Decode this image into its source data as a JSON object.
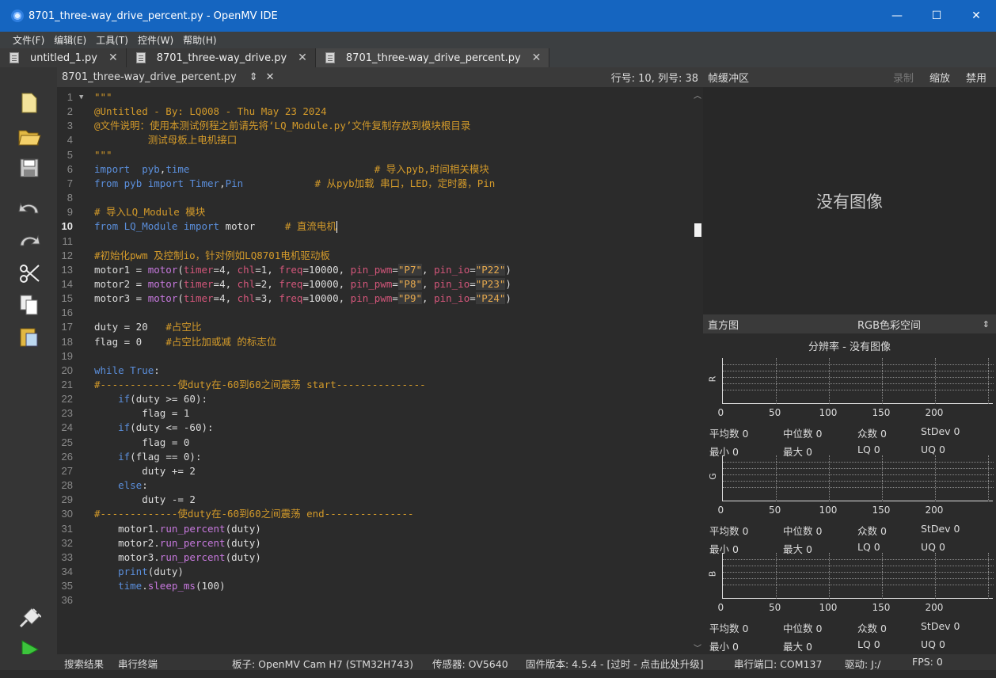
{
  "window": {
    "title": "8701_three-way_drive_percent.py - OpenMV IDE",
    "min": "—",
    "max": "☐",
    "close": "✕"
  },
  "menu": [
    "文件(F)",
    "编辑(E)",
    "工具(T)",
    "控件(W)",
    "帮助(H)"
  ],
  "tabs": [
    {
      "label": "untitled_1.py"
    },
    {
      "label": "8701_three-way_drive.py"
    },
    {
      "label": "8701_three-way_drive_percent.py"
    }
  ],
  "editor_header": {
    "file": "8701_three-way_drive_percent.py",
    "arrows": "⇕",
    "close": "✕",
    "position": "行号: 10, 列号: 38"
  },
  "code_lines": [
    "\"\"\"",
    "@Untitled - By: LQ008 - Thu May 23 2024",
    "@文件说明：使用本测试例程之前请先将‘LQ_Module.py’文件复制存放到模块根目录",
    "         测试母板上电机接口",
    "\"\"\"",
    "import  pyb,time                               # 导入pyb,时间相关模块",
    "from pyb import Timer,Pin            # 从pyb加载 串口，LED，定时器，Pin",
    "",
    "# 导入LQ_Module 模块",
    "from LQ_Module import motor     # 直流电机",
    "",
    "#初始化pwm 及控制io，针对例如LQ8701电机驱动板",
    "motor1 = motor(timer=4, chl=1, freq=10000, pin_pwm=\"P7\", pin_io=\"P22\")",
    "motor2 = motor(timer=4, chl=2, freq=10000, pin_pwm=\"P8\", pin_io=\"P23\")",
    "motor3 = motor(timer=4, chl=3, freq=10000, pin_pwm=\"P9\", pin_io=\"P24\")",
    "",
    "duty = 20   #占空比",
    "flag = 0    #占空比加或减 的标志位",
    "",
    "while True:",
    "#-------------使duty在-60到60之间震荡 start---------------",
    "    if(duty >= 60):",
    "        flag = 1",
    "    if(duty <= -60):",
    "        flag = 0",
    "    if(flag == 0):",
    "        duty += 2",
    "    else:",
    "        duty -= 2",
    "#-------------使duty在-60到60之间震荡 end---------------",
    "    motor1.run_percent(duty)",
    "    motor2.run_percent(duty)",
    "    motor3.run_percent(duty)",
    "    print(duty)",
    "    time.sleep_ms(100)",
    ""
  ],
  "framebuffer": {
    "label": "帧缓冲区",
    "record": "录制",
    "zoom": "缩放",
    "disable": "禁用",
    "no_image": "没有图像"
  },
  "histogram": {
    "label": "直方图",
    "colorspace": "RGB色彩空间",
    "arrow": "⇕",
    "subtitle": "分辨率 - 没有图像",
    "ticks": [
      "0",
      "50",
      "100",
      "150",
      "200"
    ],
    "channels": [
      {
        "name": "R",
        "mean": "平均数 0",
        "median": "中位数 0",
        "mode": "众数 0",
        "stdev": "StDev 0",
        "min": "最小   0",
        "max": "最大   0",
        "lq": "LQ   0",
        "uq": "UQ    0"
      },
      {
        "name": "G",
        "mean": "平均数 0",
        "median": "中位数 0",
        "mode": "众数 0",
        "stdev": "StDev 0",
        "min": "最小   0",
        "max": "最大   0",
        "lq": "LQ   0",
        "uq": "UQ    0"
      },
      {
        "name": "B",
        "mean": "平均数 0",
        "median": "中位数 0",
        "mode": "众数 0",
        "stdev": "StDev 0",
        "min": "最小   0",
        "max": "最大   0",
        "lq": "LQ   0",
        "uq": "UQ    0"
      }
    ]
  },
  "status": {
    "search": "搜索结果",
    "serial_terminal": "串行终端",
    "board": "板子: OpenMV Cam H7 (STM32H743)",
    "sensor": "传感器: OV5640",
    "firmware": "固件版本: 4.5.4 - [过时 - 点击此处升级]",
    "port": "串行端口: COM137",
    "drive": "驱动: J:/",
    "fps": "FPS: 0"
  }
}
